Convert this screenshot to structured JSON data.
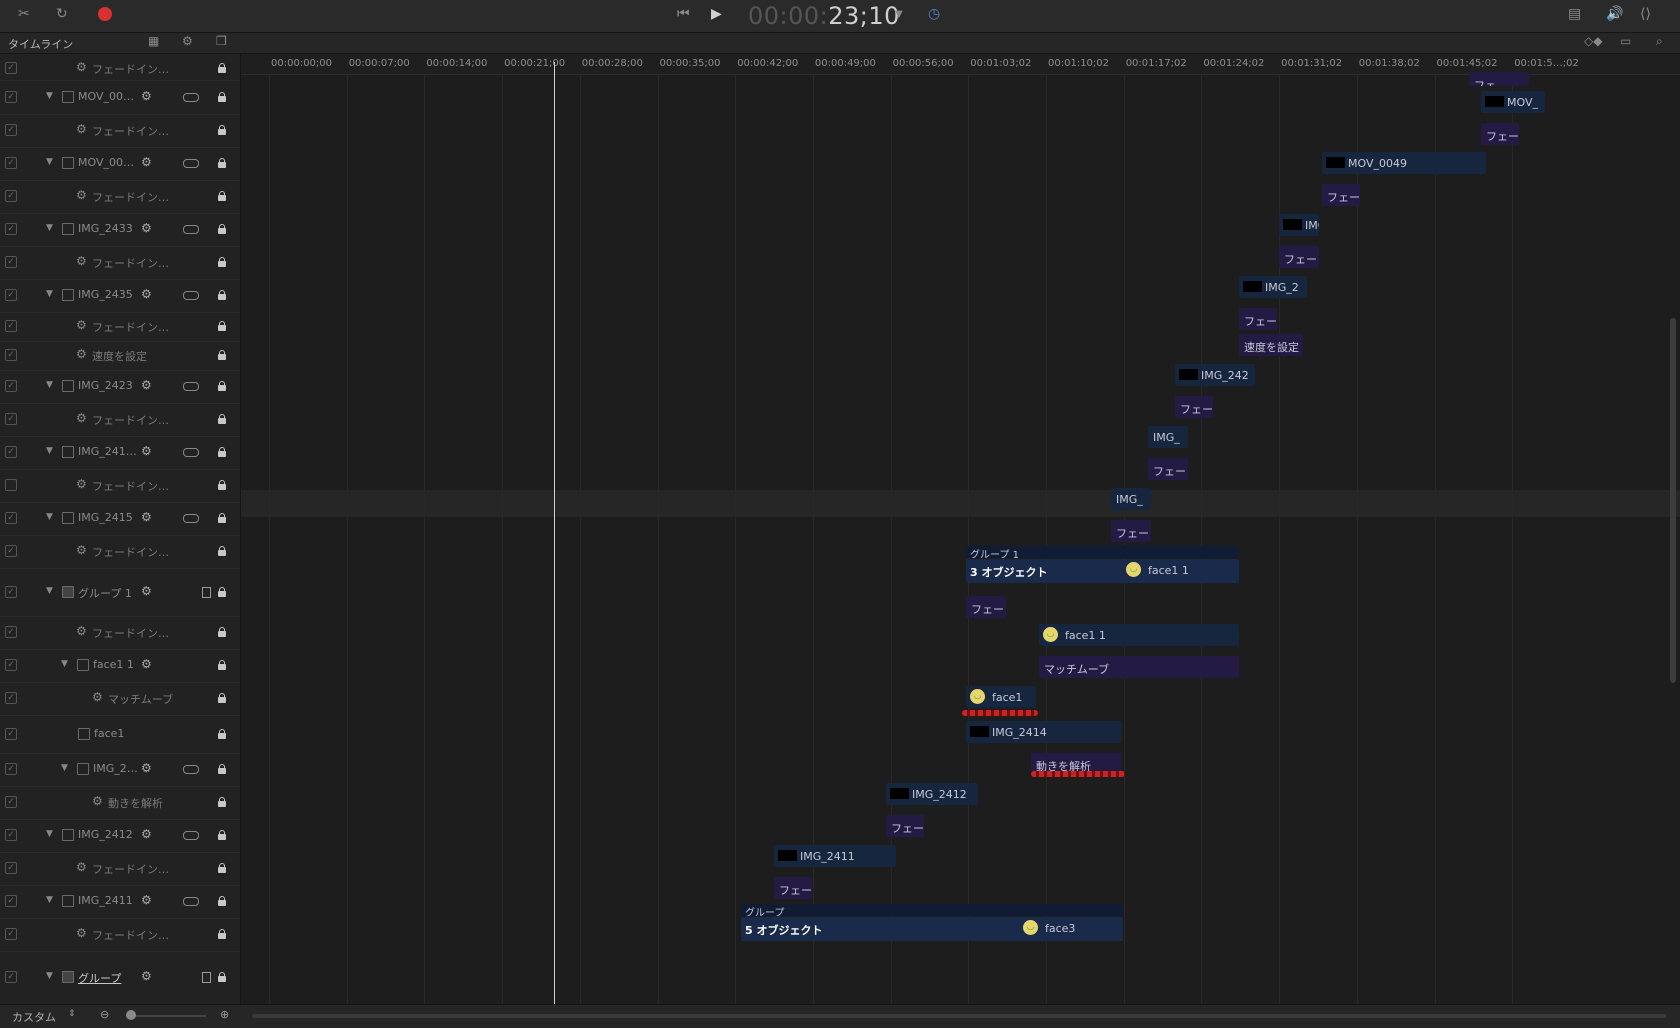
{
  "toolbar": {
    "timecode_dim": "00:00:",
    "timecode_bright": "23;10"
  },
  "panel": {
    "title": "タイムライン"
  },
  "sidebar": {
    "rows": [
      {
        "label": "フェードイン…",
        "checked": true
      },
      {
        "label": "MOV_00…",
        "checked": true
      },
      {
        "label": "フェードイン…",
        "checked": true
      },
      {
        "label": "MOV_00…",
        "checked": true
      },
      {
        "label": "フェードイン…",
        "checked": true
      },
      {
        "label": "IMG_2433",
        "checked": true
      },
      {
        "label": "フェードイン…",
        "checked": true
      },
      {
        "label": "IMG_2435",
        "checked": true
      },
      {
        "label": "フェードイン…",
        "checked": true
      },
      {
        "label": "速度を設定",
        "checked": true
      },
      {
        "label": "IMG_2423",
        "checked": true
      },
      {
        "label": "フェードイン…",
        "checked": true
      },
      {
        "label": "IMG_241…",
        "checked": true
      },
      {
        "label": "フェードイン…",
        "checked": false
      },
      {
        "label": "IMG_2415",
        "checked": true
      },
      {
        "label": "フェードイン…",
        "checked": true
      },
      {
        "label": "グループ 1",
        "checked": true
      },
      {
        "label": "フェードイン…",
        "checked": true
      },
      {
        "label": "face1 1",
        "checked": true
      },
      {
        "label": "マッチムーブ",
        "checked": true
      },
      {
        "label": "face1",
        "checked": true
      },
      {
        "label": "IMG_2…",
        "checked": true
      },
      {
        "label": "動きを解析",
        "checked": true
      },
      {
        "label": "IMG_2412",
        "checked": true
      },
      {
        "label": "フェードイン…",
        "checked": true
      },
      {
        "label": "IMG_2411",
        "checked": true
      },
      {
        "label": "フェードイン…",
        "checked": true
      },
      {
        "label": "グループ",
        "checked": true
      }
    ]
  },
  "bottom": {
    "view_label": "カスタム"
  },
  "ruler": {
    "ticks": [
      "00:00:00;00",
      "00:00:07;00",
      "00:00:14;00",
      "00:00:21;00",
      "00:00:28;00",
      "00:00:35;00",
      "00:00:42;00",
      "00:00:49;00",
      "00:00:56;00",
      "00:01:03;02",
      "00:01:10;02",
      "00:01:17;02",
      "00:01:24;02",
      "00:01:31;02",
      "00:01:38;02",
      "00:01:45;02",
      "00:01:5…;02"
    ]
  },
  "clips": [
    {
      "label": "フェ",
      "kind": "purple"
    },
    {
      "label": "MOV_",
      "kind": "blue"
    },
    {
      "label": "フェー",
      "kind": "purple"
    },
    {
      "label": "MOV_0049",
      "kind": "blue"
    },
    {
      "label": "フェー",
      "kind": "purple"
    },
    {
      "label": "IMG",
      "kind": "blue"
    },
    {
      "label": "フェー",
      "kind": "purple"
    },
    {
      "label": "IMG_2",
      "kind": "blue"
    },
    {
      "label": "フェー",
      "kind": "purple"
    },
    {
      "label": "速度を設定",
      "kind": "purple"
    },
    {
      "label": "IMG_242",
      "kind": "blue"
    },
    {
      "label": "フェー",
      "kind": "purple"
    },
    {
      "label": "IMG_",
      "kind": "blue"
    },
    {
      "label": "フェー",
      "kind": "purple"
    },
    {
      "label": "IMG_",
      "kind": "blue"
    },
    {
      "label": "フェー",
      "kind": "purple"
    },
    {
      "label": "フェー",
      "kind": "purple"
    },
    {
      "label": "face1 1",
      "kind": "blue"
    },
    {
      "label": "マッチムーブ",
      "kind": "purple"
    },
    {
      "label": "face1",
      "kind": "blue"
    },
    {
      "label": "IMG_2414",
      "kind": "blue"
    },
    {
      "label": "動きを解析",
      "kind": "purple"
    },
    {
      "label": "IMG_2412",
      "kind": "blue"
    },
    {
      "label": "フェー",
      "kind": "purple"
    },
    {
      "label": "IMG_2411",
      "kind": "blue"
    },
    {
      "label": "フェー",
      "kind": "purple"
    }
  ],
  "groups": [
    {
      "title": "グループ 1",
      "count": "3 オブジェクト",
      "face": "face1 1"
    },
    {
      "title": "グループ",
      "count": "5 オブジェクト",
      "face": "face3"
    }
  ]
}
